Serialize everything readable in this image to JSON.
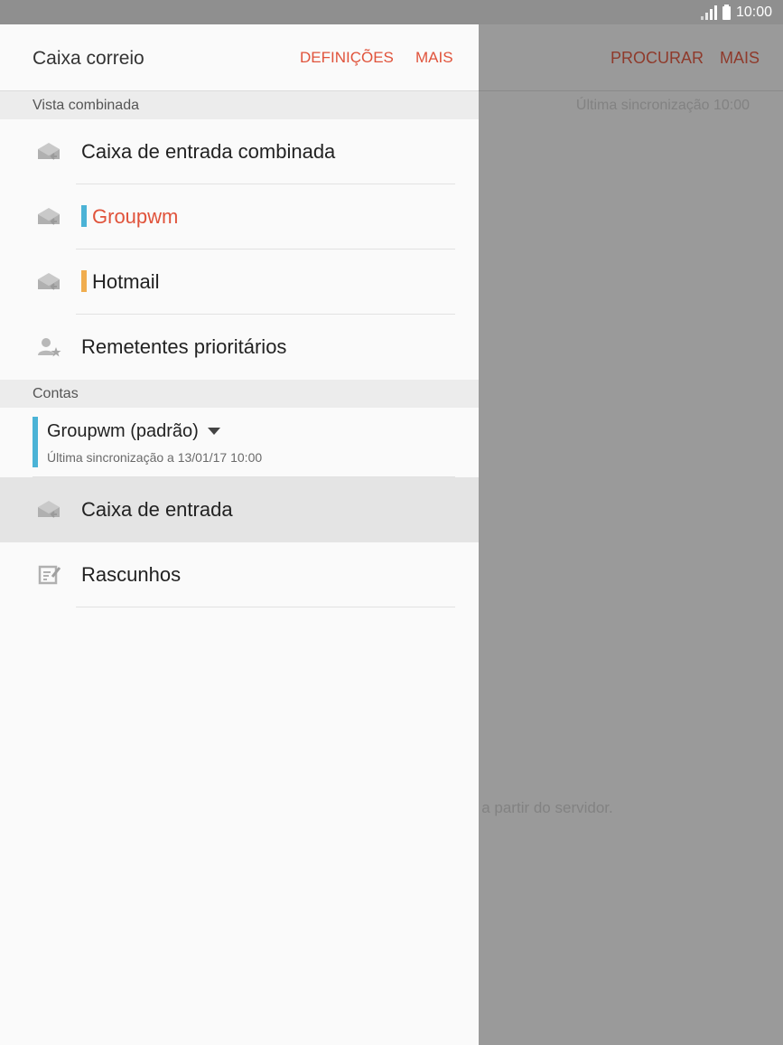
{
  "status_bar": {
    "time": "10:00"
  },
  "background": {
    "actions": [
      "PROCURAR",
      "MAIS"
    ],
    "last_sync": "Última sincronização  10:00",
    "message_fragment": "s a partir do servidor."
  },
  "drawer": {
    "title": "Caixa correio",
    "actions": {
      "settings": "DEFINIÇÕES",
      "more": "MAIS"
    },
    "combined_view": {
      "section_label": "Vista combinada",
      "items": [
        {
          "label": "Caixa de entrada combinada",
          "icon": "inbox-icon"
        },
        {
          "label": "Groupwm",
          "icon": "inbox-icon",
          "account_color": "#4bb3d6",
          "text_color": "#e0533b"
        },
        {
          "label": "Hotmail",
          "icon": "inbox-icon",
          "account_color": "#f0ad4e"
        },
        {
          "label": "Remetentes prioritários",
          "icon": "priority-sender-icon"
        }
      ]
    },
    "accounts": {
      "section_label": "Contas",
      "current": {
        "name": "Groupwm (padrão)",
        "sync": "Última sincronização a 13/01/17  10:00",
        "color": "#4bb3d6"
      },
      "folders": [
        {
          "label": "Caixa de entrada",
          "icon": "inbox-icon",
          "selected": true
        },
        {
          "label": "Rascunhos",
          "icon": "drafts-icon"
        }
      ]
    }
  },
  "colors": {
    "accent": "#e0533b",
    "groupwm": "#4bb3d6",
    "hotmail": "#f0ad4e"
  }
}
